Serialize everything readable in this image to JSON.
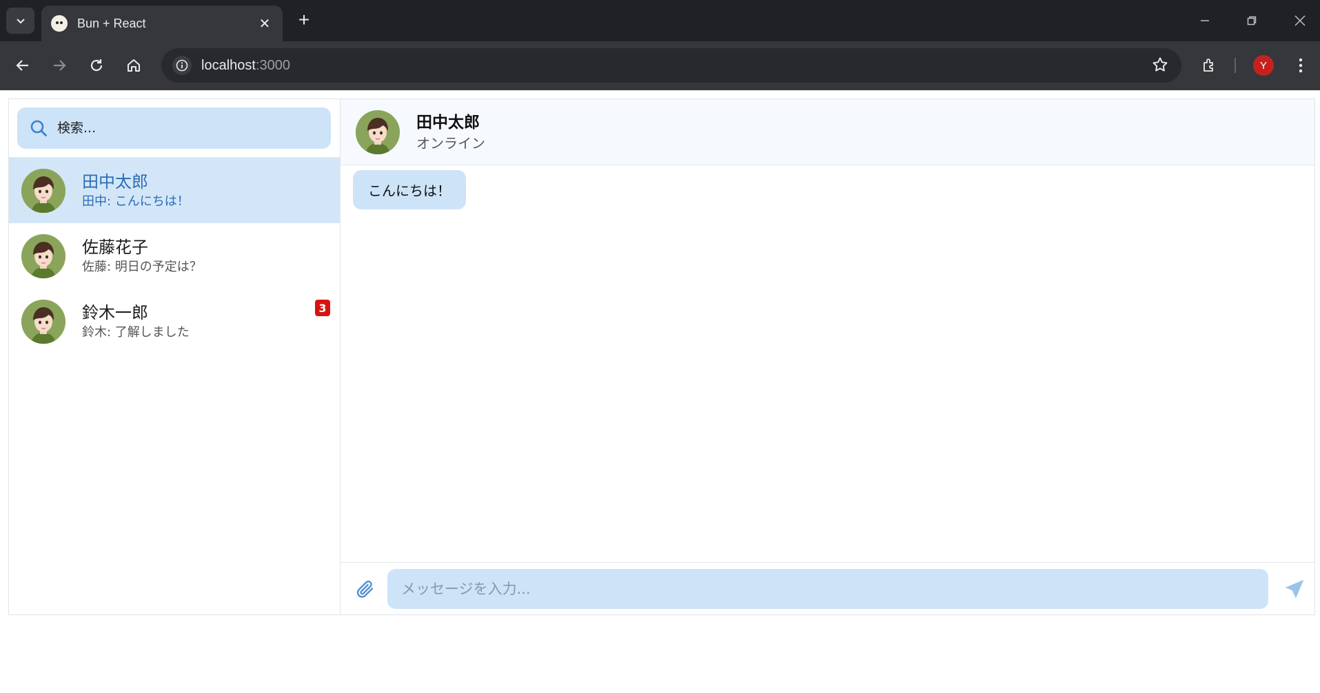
{
  "browser": {
    "tab_title": "Bun + React",
    "url_host": "localhost",
    "url_port": ":3000",
    "profile_initial": "Y"
  },
  "search": {
    "placeholder": "検索..."
  },
  "chats": [
    {
      "name": "田中太郎",
      "preview": "田中: こんにちは！",
      "active": true,
      "unread": ""
    },
    {
      "name": "佐藤花子",
      "preview": "佐藤: 明日の予定は？",
      "active": false,
      "unread": ""
    },
    {
      "name": "鈴木一郎",
      "preview": "鈴木: 了解しました",
      "active": false,
      "unread": "3"
    }
  ],
  "conversation": {
    "name": "田中太郎",
    "status": "オンライン",
    "messages": [
      {
        "text": "こんにちは！"
      }
    ]
  },
  "composer": {
    "placeholder": "メッセージを入力..."
  },
  "colors": {
    "accent": "#2a6db5",
    "bubble": "#cde3f8",
    "badge": "#d6140f"
  }
}
